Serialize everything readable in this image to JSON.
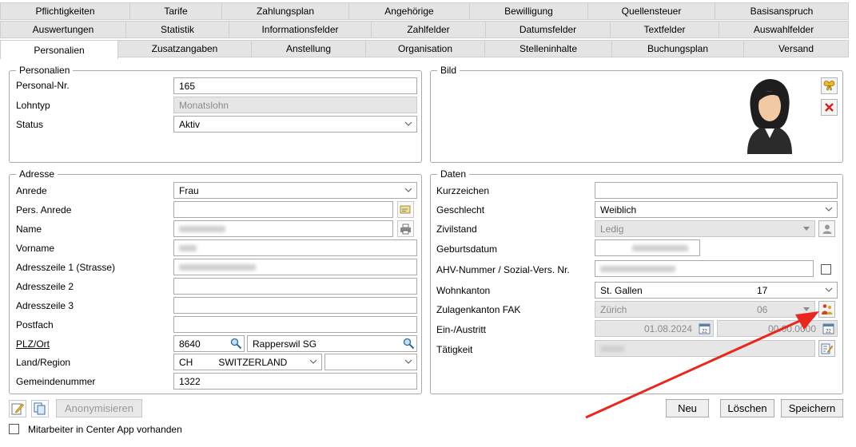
{
  "tabs": {
    "row1": [
      "Pflichtigkeiten",
      "Tarife",
      "Zahlungsplan",
      "Angehörige",
      "Bewilligung",
      "Quellensteuer",
      "Basisanspruch"
    ],
    "row2": [
      "Auswertungen",
      "Statistik",
      "Informationsfelder",
      "Zahlfelder",
      "Datumsfelder",
      "Textfelder",
      "Auswahlfelder"
    ],
    "row3": [
      "Personalien",
      "Zusatzangaben",
      "Anstellung",
      "Organisation",
      "Stelleninhalte",
      "Buchungsplan",
      "Versand"
    ],
    "active": "Personalien"
  },
  "personalien": {
    "legend": "Personalien",
    "personal_nr_label": "Personal-Nr.",
    "personal_nr_value": "165",
    "lohntyp_label": "Lohntyp",
    "lohntyp_value": "Monatslohn",
    "status_label": "Status",
    "status_value": "Aktiv"
  },
  "bild": {
    "legend": "Bild"
  },
  "adresse": {
    "legend": "Adresse",
    "anrede_label": "Anrede",
    "anrede_value": "Frau",
    "pers_anrede_label": "Pers. Anrede",
    "name_label": "Name",
    "vorname_label": "Vorname",
    "adresszeile1_label": "Adresszeile 1 (Strasse)",
    "adresszeile2_label": "Adresszeile 2",
    "adresszeile3_label": "Adresszeile 3",
    "postfach_label": "Postfach",
    "plz_ort_label": "PLZ/Ort",
    "plz_value": "8640",
    "ort_value": "Rapperswil SG",
    "land_label": "Land/Region",
    "land_code": "CH",
    "land_name": "SWITZERLAND",
    "gemeinde_label": "Gemeindenummer",
    "gemeinde_value": "1322"
  },
  "daten": {
    "legend": "Daten",
    "kurzzeichen_label": "Kurzzeichen",
    "geschlecht_label": "Geschlecht",
    "geschlecht_value": "Weiblich",
    "zivilstand_label": "Zivilstand",
    "zivilstand_value": "Ledig",
    "geburtsdatum_label": "Geburtsdatum",
    "ahv_label": "AHV-Nummer / Sozial-Vers. Nr.",
    "wohnkanton_label": "Wohnkanton",
    "wohnkanton_value": "St. Gallen",
    "wohnkanton_code": "17",
    "zulagenkanton_label": "Zulagenkanton FAK",
    "zulagenkanton_value": "Zürich",
    "zulagenkanton_code": "06",
    "einaustritt_label": "Ein-/Austritt",
    "eintritt_value": "01.08.2024",
    "austritt_value": "00.00.0000",
    "taetigkeit_label": "Tätigkeit"
  },
  "footer": {
    "anonymisieren_label": "Anonymisieren",
    "neu_label": "Neu",
    "loeschen_label": "Löschen",
    "speichern_label": "Speichern",
    "center_app_label": "Mitarbeiter in Center App vorhanden"
  },
  "colors": {
    "arrow": "#e8281e",
    "tab_bg": "#e4e4e4",
    "disabled_bg": "#e6e6e6"
  }
}
